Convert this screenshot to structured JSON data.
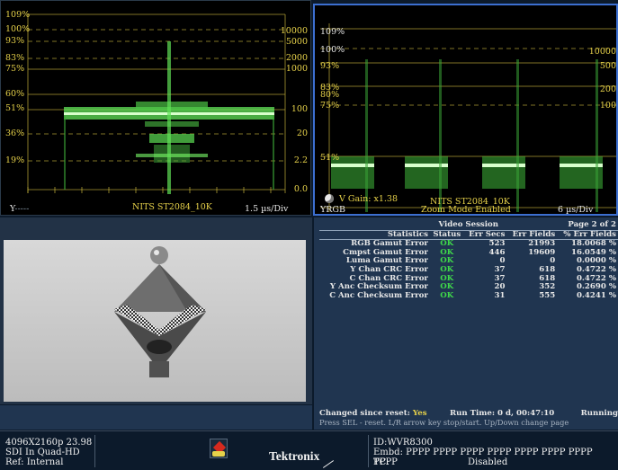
{
  "waveform_left": {
    "pct_labels": [
      "109%",
      "100%",
      "93%",
      "83%",
      "75%",
      "60%",
      "51%",
      "36%",
      "19%"
    ],
    "nits_labels": [
      "10000",
      "5000",
      "2000",
      "1000",
      "100",
      "20",
      "2.2",
      "0.0"
    ],
    "channel": "Y",
    "channel_trail": "-----",
    "curve": "NITS  ST2084_10K",
    "sweep": "1.5 µs/Div"
  },
  "waveform_right": {
    "pct_labels": [
      "109%",
      "100%",
      "93%",
      "83%",
      "80%",
      "75%",
      "51%"
    ],
    "nits_labels": [
      "10000",
      "500",
      "200",
      "100"
    ],
    "gain": "V Gain: x1.38",
    "channel": "YRGB",
    "curve": "NITS  ST2084_10K",
    "zoom": "Zoom Mode Enabled",
    "sweep": "6 µs/Div"
  },
  "stats": {
    "session_title": "Video Session",
    "page_label": "Page 2 of 2",
    "headers": [
      "Statistics",
      "Status",
      "Err Secs",
      "Err Fields",
      "% Err Fields"
    ],
    "rows": [
      {
        "name": "RGB Gamut Error",
        "status": "OK",
        "secs": "523",
        "fields": "21993",
        "pct": "18.0068 %"
      },
      {
        "name": "Cmpst Gamut Error",
        "status": "OK",
        "secs": "446",
        "fields": "19609",
        "pct": "16.0549 %"
      },
      {
        "name": "Luma Gamut Error",
        "status": "OK",
        "secs": "0",
        "fields": "0",
        "pct": "0.0000 %"
      },
      {
        "name": "Y Chan CRC Error",
        "status": "OK",
        "secs": "37",
        "fields": "618",
        "pct": "0.4722 %"
      },
      {
        "name": "C Chan CRC Error",
        "status": "OK",
        "secs": "37",
        "fields": "618",
        "pct": "0.4722 %"
      },
      {
        "name": "Y Anc Checksum Error",
        "status": "OK",
        "secs": "20",
        "fields": "352",
        "pct": "0.2690 %"
      },
      {
        "name": "C Anc Checksum Error",
        "status": "OK",
        "secs": "31",
        "fields": "555",
        "pct": "0.4241 %"
      }
    ],
    "changed_label": "Changed since reset:",
    "changed_value": "Yes",
    "run_time": "Run Time: 0 d, 00:47:10",
    "state": "Running",
    "hint": "Press SEL - reset. L/R arrow key stop/start. Up/Down change page"
  },
  "footer": {
    "format": "4096X2160p 23.98",
    "input": "SDI In Quad-HD",
    "ref": "Ref: Internal",
    "brand": "Tektronix",
    "id": "ID:WVR8300",
    "embd": "Embd: PPPP PPPP PPPP PPPP PPPP PPPP PPPP PPPP",
    "tc_label": "TC:",
    "tc_value": "Disabled"
  },
  "colors": {
    "accent": "#3c6fd0",
    "ok": "#3fd94a",
    "graticule": "#e7d24a",
    "trace": "#6dff6d"
  }
}
